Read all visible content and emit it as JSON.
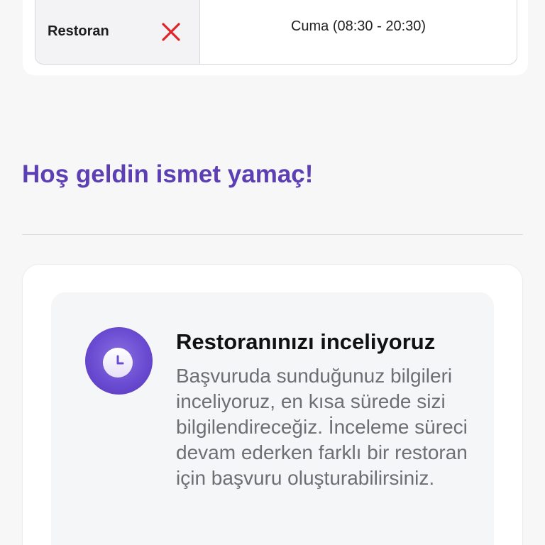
{
  "hours_table": {
    "row_label": "Restoran",
    "status_icon": "close-icon",
    "status_color": "#e0242a",
    "value": "Cuma (08:30 - 20:30)"
  },
  "greeting": "Hoş geldin ismet yamaç!",
  "review_status": {
    "icon": "clock-icon",
    "title": "Restoranınızı inceliyoruz",
    "description": "Başvuruda sunduğunuz bilgileri inceliyoruz, en kısa sürede sizi bilgilendireceğiz. İnceleme süreci devam ederken farklı bir restoran için başvuru oluşturabilirsiniz."
  },
  "colors": {
    "accent": "#5b3fb3",
    "error": "#e0242a"
  }
}
